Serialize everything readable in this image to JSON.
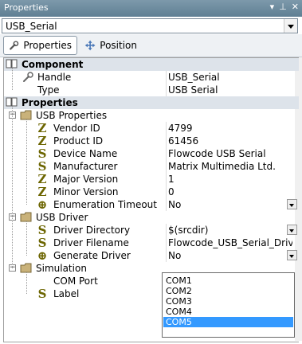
{
  "window": {
    "title": "Properties",
    "pin_glyph": "▾ ✦ ✕"
  },
  "object_selector": {
    "value": "USB_Serial"
  },
  "tabs": [
    {
      "label": "Properties"
    },
    {
      "label": "Position"
    }
  ],
  "sections": {
    "component": "Component",
    "properties": "Properties"
  },
  "rows": {
    "handle": {
      "name": "Handle",
      "value": "USB_Serial"
    },
    "type": {
      "name": "Type",
      "value": "USB Serial"
    },
    "usb_properties": {
      "name": "USB Properties"
    },
    "vendor_id": {
      "name": "Vendor ID",
      "value": "4799"
    },
    "product_id": {
      "name": "Product ID",
      "value": "61456"
    },
    "device_name": {
      "name": "Device Name",
      "value": "Flowcode USB Serial"
    },
    "manufacturer": {
      "name": "Manufacturer",
      "value": "Matrix Multimedia Ltd."
    },
    "major_version": {
      "name": "Major Version",
      "value": "1"
    },
    "minor_version": {
      "name": "Minor Version",
      "value": "0"
    },
    "enumeration_timeout": {
      "name": "Enumeration Timeout",
      "value": "No"
    },
    "usb_driver": {
      "name": "USB Driver"
    },
    "driver_directory": {
      "name": "Driver Directory",
      "value": "$(srcdir)"
    },
    "driver_filename": {
      "name": "Driver Filename",
      "value": "Flowcode_USB_Serial_Driver"
    },
    "generate_driver": {
      "name": "Generate Driver",
      "value": "No"
    },
    "simulation": {
      "name": "Simulation"
    },
    "com_port": {
      "name": "COM Port",
      "value": ""
    },
    "label": {
      "name": "Label",
      "value": ""
    }
  },
  "com_dropdown": {
    "options": [
      "COM1",
      "COM2",
      "COM3",
      "COM4",
      "COM5"
    ],
    "selected": "COM5"
  },
  "colors": {
    "titlebar": "#6b8a9e",
    "selection": "#3399ff",
    "category_bg": "#dde3ea",
    "icon_olive": "#6c6500"
  }
}
